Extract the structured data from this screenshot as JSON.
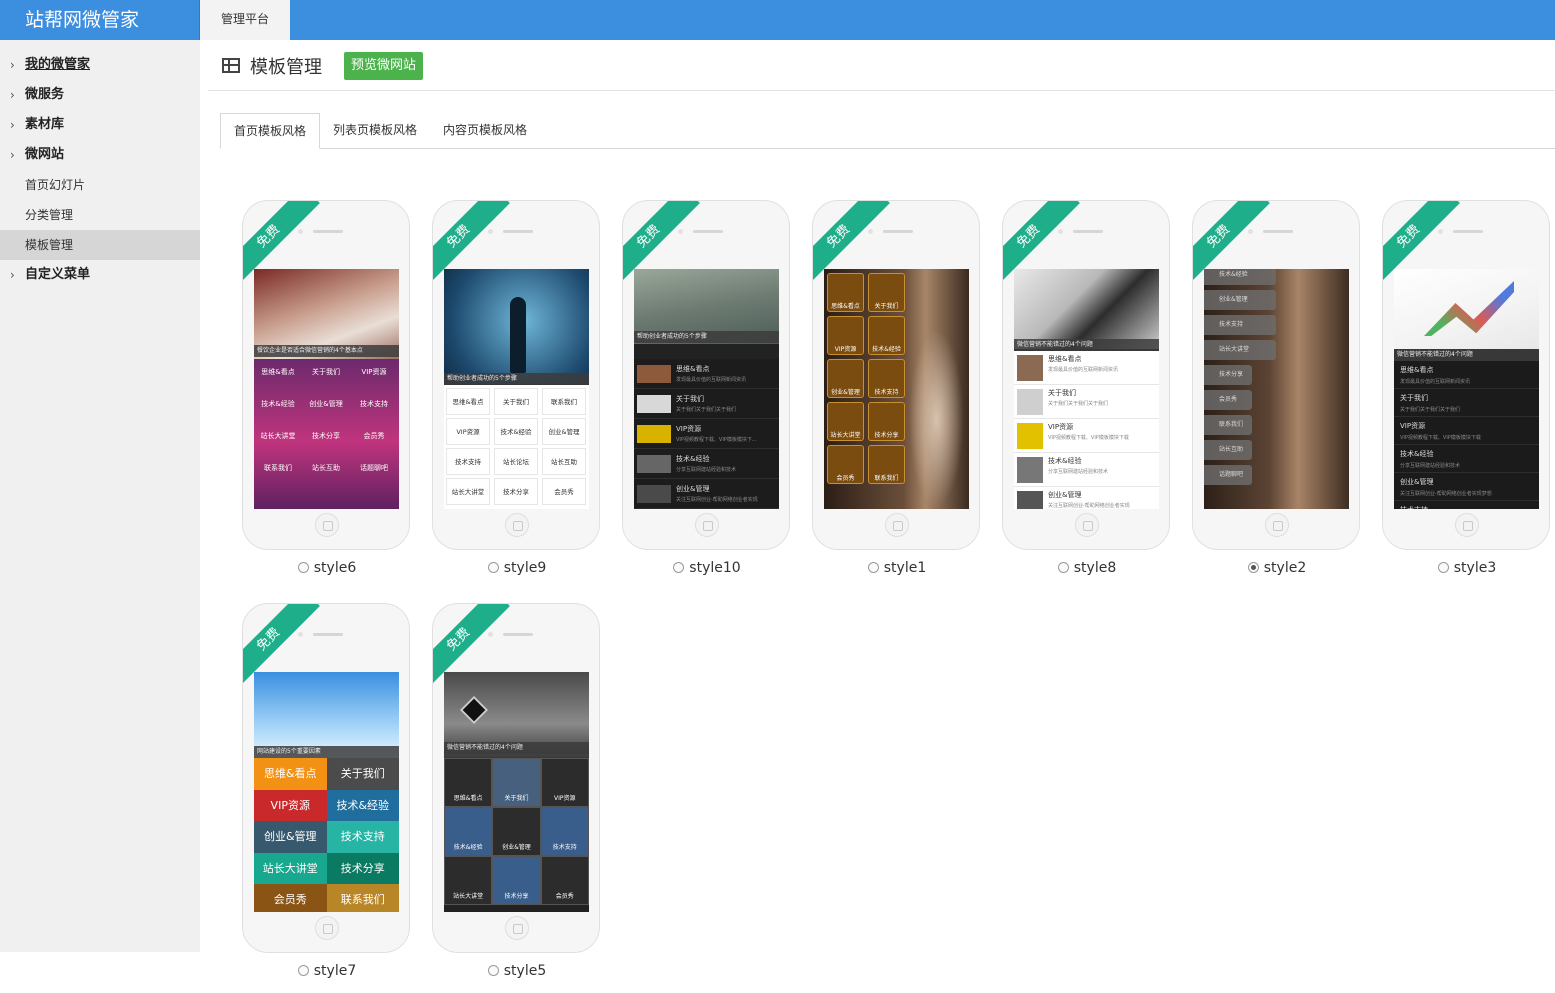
{
  "app": {
    "brand": "站帮网微管家",
    "top_tab": "管理平台"
  },
  "sidebar": {
    "items": [
      {
        "label": "我的微管家",
        "type": "parent"
      },
      {
        "label": "微服务",
        "type": "parent"
      },
      {
        "label": "素材库",
        "type": "parent"
      },
      {
        "label": "微网站",
        "type": "parent"
      },
      {
        "label": "首页幻灯片",
        "type": "sub"
      },
      {
        "label": "分类管理",
        "type": "sub"
      },
      {
        "label": "模板管理",
        "type": "sub",
        "active": true
      },
      {
        "label": "自定义菜单",
        "type": "parent"
      }
    ]
  },
  "page": {
    "title": "模板管理",
    "preview_button": "预览微网站"
  },
  "tabs": [
    {
      "label": "首页模板风格",
      "active": true
    },
    {
      "label": "列表页模板风格"
    },
    {
      "label": "内容页模板风格"
    }
  ],
  "templates": [
    {
      "name": "style6",
      "badge": "免费",
      "selected": false,
      "caption": "餐饮企业是否适合微信营销的4个基本点",
      "cells": [
        "思维&看点",
        "关于我们",
        "VIP资源",
        "技术&经验",
        "创业&管理",
        "技术支持",
        "站长大讲堂",
        "技术分享",
        "会员秀",
        "联系我们",
        "站长互助",
        "话题聊吧"
      ]
    },
    {
      "name": "style9",
      "badge": "免费",
      "selected": false,
      "caption": "帮助创业者成功的5个步骤",
      "cells": [
        "思维&看点",
        "关于我们",
        "联系我们",
        "VIP资源",
        "技术&经验",
        "创业&管理",
        "技术支持",
        "站长论坛",
        "站长互助",
        "站长大讲堂",
        "技术分享",
        "会员秀"
      ]
    },
    {
      "name": "style10",
      "badge": "免费",
      "selected": false,
      "caption": "帮助创业者成功的5个步骤",
      "rows": [
        {
          "t": "思维&看点",
          "s": "发现最具价值的互联网新闻资讯"
        },
        {
          "t": "关于我们",
          "s": "关于我们关于我们关于我们"
        },
        {
          "t": "VIP资源",
          "s": "VIP视频教程下载、VIP模板模块下..."
        },
        {
          "t": "技术&经验",
          "s": "分享互联网建站经验和技术"
        },
        {
          "t": "创业&管理",
          "s": "关注互联网创业-帮助网络创业者实现"
        }
      ]
    },
    {
      "name": "style1",
      "badge": "免费",
      "selected": false,
      "cells": [
        "思维&看点",
        "关于我们",
        "VIP资源",
        "技术&经验",
        "创业&管理",
        "技术支持",
        "站长大讲堂",
        "技术分享",
        "会员秀",
        "联系我们"
      ]
    },
    {
      "name": "style8",
      "badge": "免费",
      "selected": false,
      "caption": "微信营销不能错过的4个问题",
      "rows": [
        {
          "t": "思维&看点",
          "s": "发现最具价值的互联网新闻资讯"
        },
        {
          "t": "关于我们",
          "s": "关于我们关于我们关于我们"
        },
        {
          "t": "VIP资源",
          "s": "VIP视频教程下载、VIP模板模块下载"
        },
        {
          "t": "技术&经验",
          "s": "分享互联网建站经验和技术"
        },
        {
          "t": "创业&管理",
          "s": "关注互联网创业-帮助网络创业者实现"
        }
      ]
    },
    {
      "name": "style2",
      "badge": "免费",
      "selected": true,
      "cells": [
        "技术&经验",
        "创业&管理",
        "技术支持",
        "站长大讲堂",
        "技术分享",
        "会员秀",
        "联系我们",
        "站长互助",
        "话题聊吧"
      ]
    },
    {
      "name": "style3",
      "badge": "免费",
      "selected": false,
      "caption": "微信营销不能错过的4个问题",
      "rows": [
        {
          "t": "思维&看点",
          "s": "发现最具价值的互联网新闻资讯"
        },
        {
          "t": "关于我们",
          "s": "关于我们关于我们关于我们"
        },
        {
          "t": "VIP资源",
          "s": "VIP视频教程下载、VIP模板模块下载"
        },
        {
          "t": "技术&经验",
          "s": "分享互联网建站经验和技术"
        },
        {
          "t": "创业&管理",
          "s": "关注互联网创业-帮助网络创业者实现梦想"
        },
        {
          "t": "技术支持",
          "s": ""
        }
      ]
    },
    {
      "name": "style7",
      "badge": "免费",
      "selected": false,
      "caption": "网站建设的5个重要因素",
      "cells": [
        "思维&看点",
        "关于我们",
        "VIP资源",
        "技术&经验",
        "创业&管理",
        "技术支持",
        "站长大讲堂",
        "技术分享",
        "会员秀",
        "联系我们"
      ]
    },
    {
      "name": "style5",
      "badge": "免费",
      "selected": false,
      "caption": "微信营销不能错过的4个问题",
      "cells": [
        "思维&看点",
        "关于我们",
        "VIP资源",
        "技术&经验",
        "创业&管理",
        "技术支持",
        "站长大讲堂",
        "技术分享",
        "会员秀"
      ]
    }
  ],
  "colors": {
    "accent": "#3c8ede",
    "ribbon": "#1fae8a",
    "preview_button": "#4cb34c"
  }
}
